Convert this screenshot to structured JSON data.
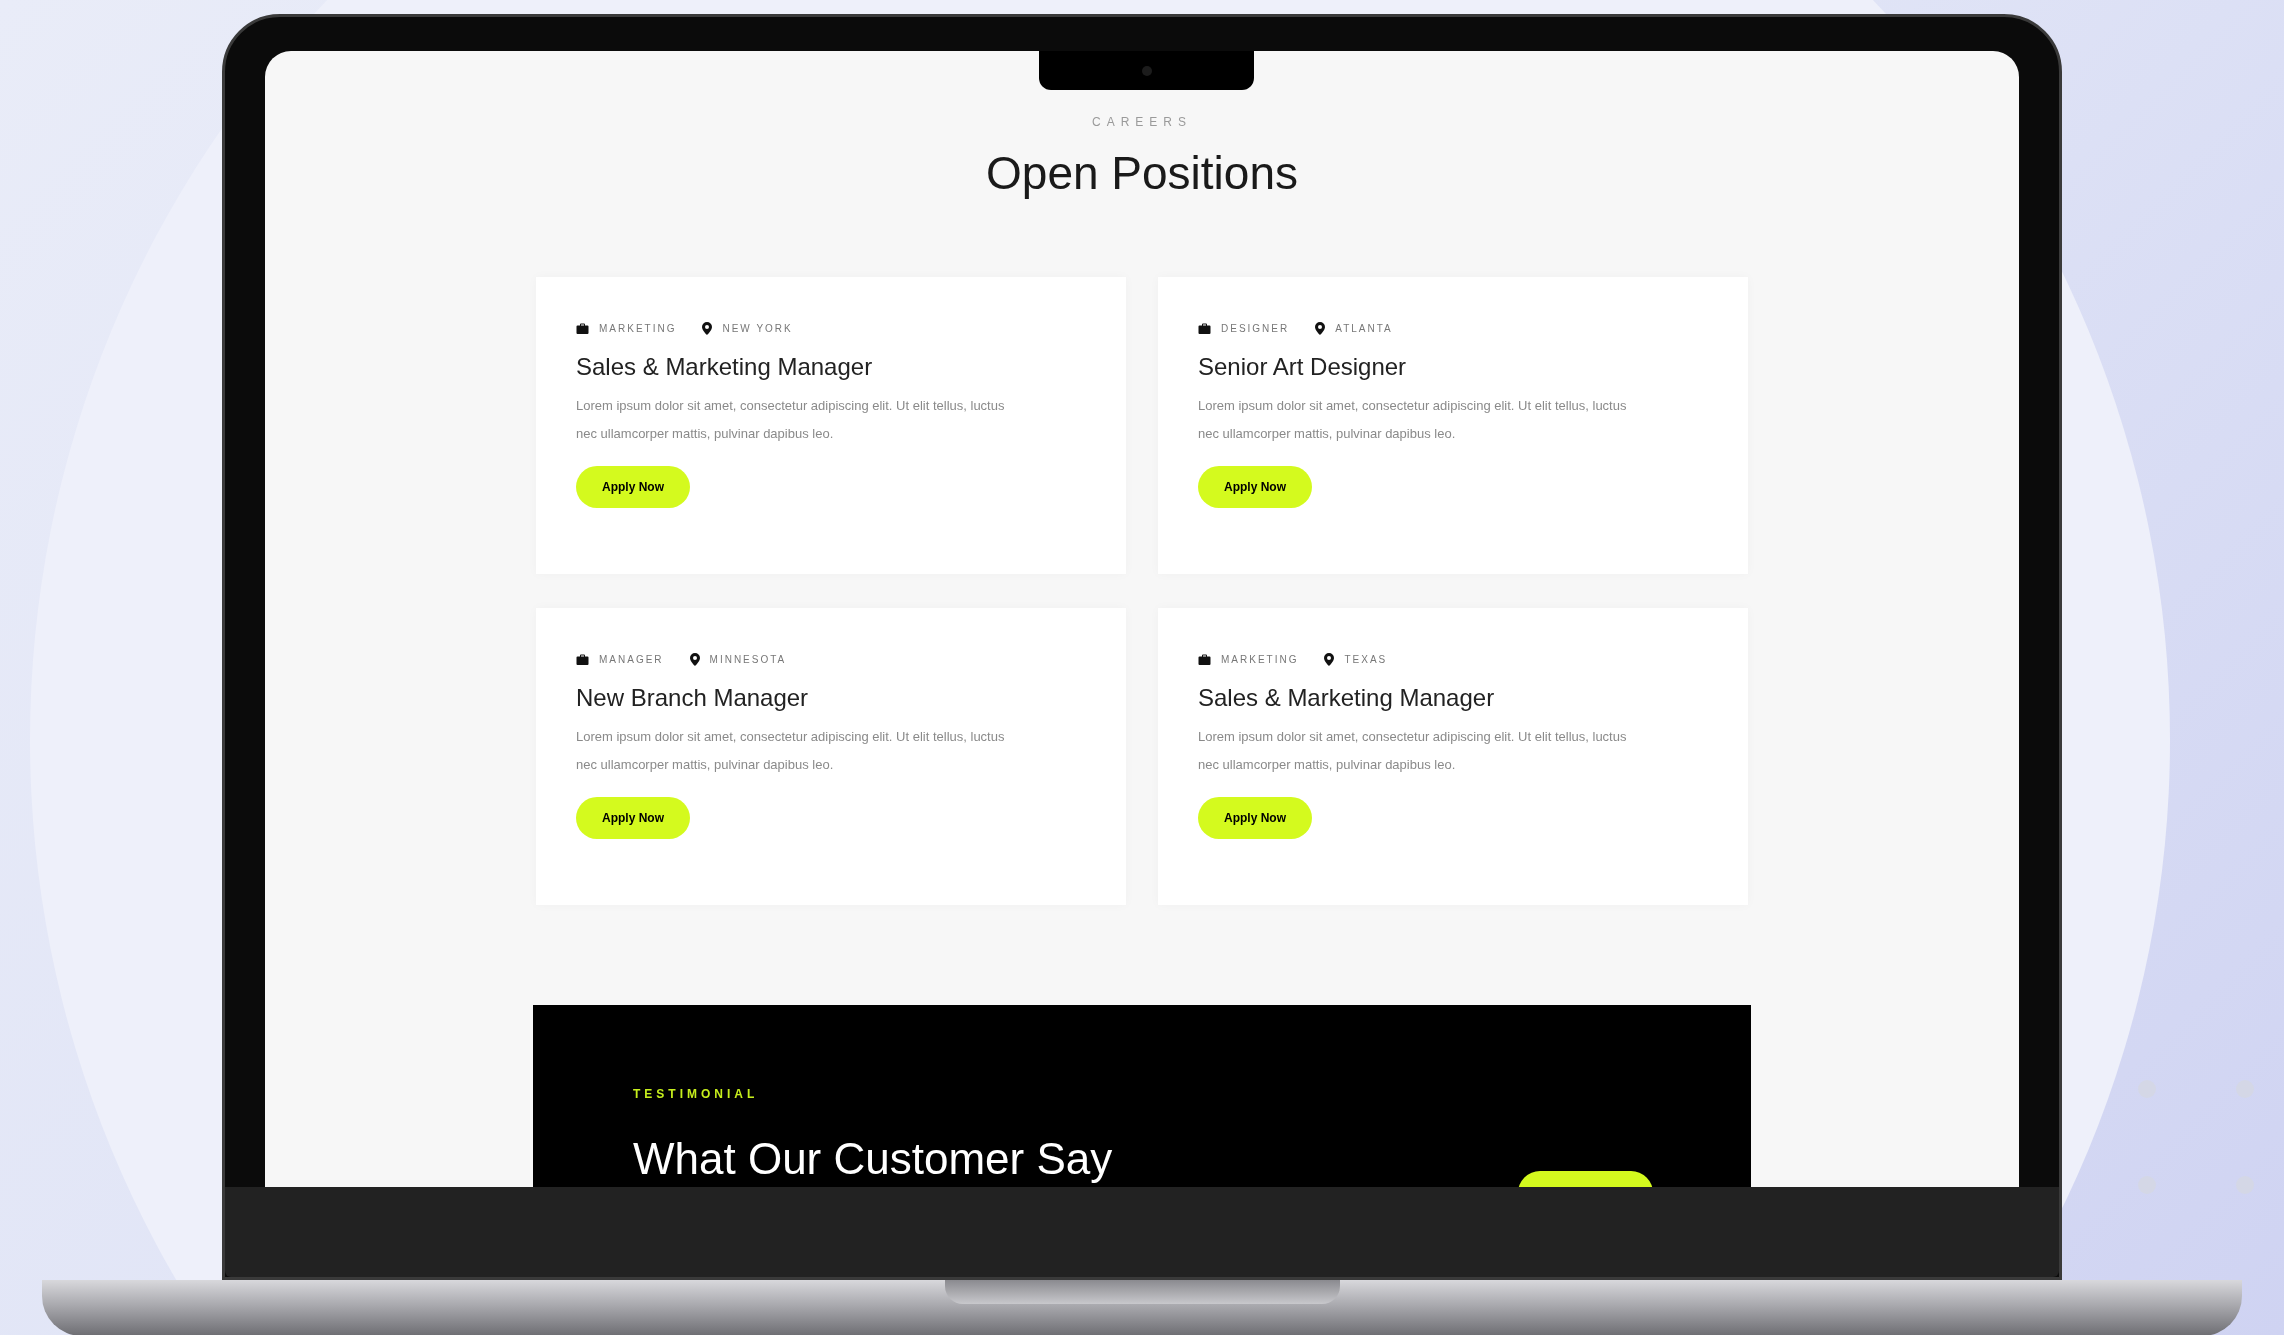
{
  "section": {
    "eyebrow": "CAREERS",
    "title": "Open Positions"
  },
  "jobs": [
    {
      "department": "MARKETING",
      "location": "NEW YORK",
      "title": "Sales & Marketing Manager",
      "description": "Lorem ipsum dolor sit amet, consectetur adipiscing elit. Ut elit tellus, luctus nec ullamcorper mattis, pulvinar dapibus leo.",
      "button": "Apply Now"
    },
    {
      "department": "DESIGNER",
      "location": "ATLANTA",
      "title": "Senior Art Designer",
      "description": "Lorem ipsum dolor sit amet, consectetur adipiscing elit. Ut elit tellus, luctus nec ullamcorper mattis, pulvinar dapibus leo.",
      "button": "Apply Now"
    },
    {
      "department": "MANAGER",
      "location": "MINNESOTA",
      "title": "New Branch Manager",
      "description": "Lorem ipsum dolor sit amet, consectetur adipiscing elit. Ut elit tellus, luctus nec ullamcorper mattis, pulvinar dapibus leo.",
      "button": "Apply Now"
    },
    {
      "department": "MARKETING",
      "location": "TEXAS",
      "title": "Sales & Marketing Manager",
      "description": "Lorem ipsum dolor sit amet, consectetur adipiscing elit. Ut elit tellus, luctus nec ullamcorper mattis, pulvinar dapibus leo.",
      "button": "Apply Now"
    }
  ],
  "testimonial": {
    "eyebrow": "TESTIMONIAL",
    "title": "What Our Customer Say"
  }
}
